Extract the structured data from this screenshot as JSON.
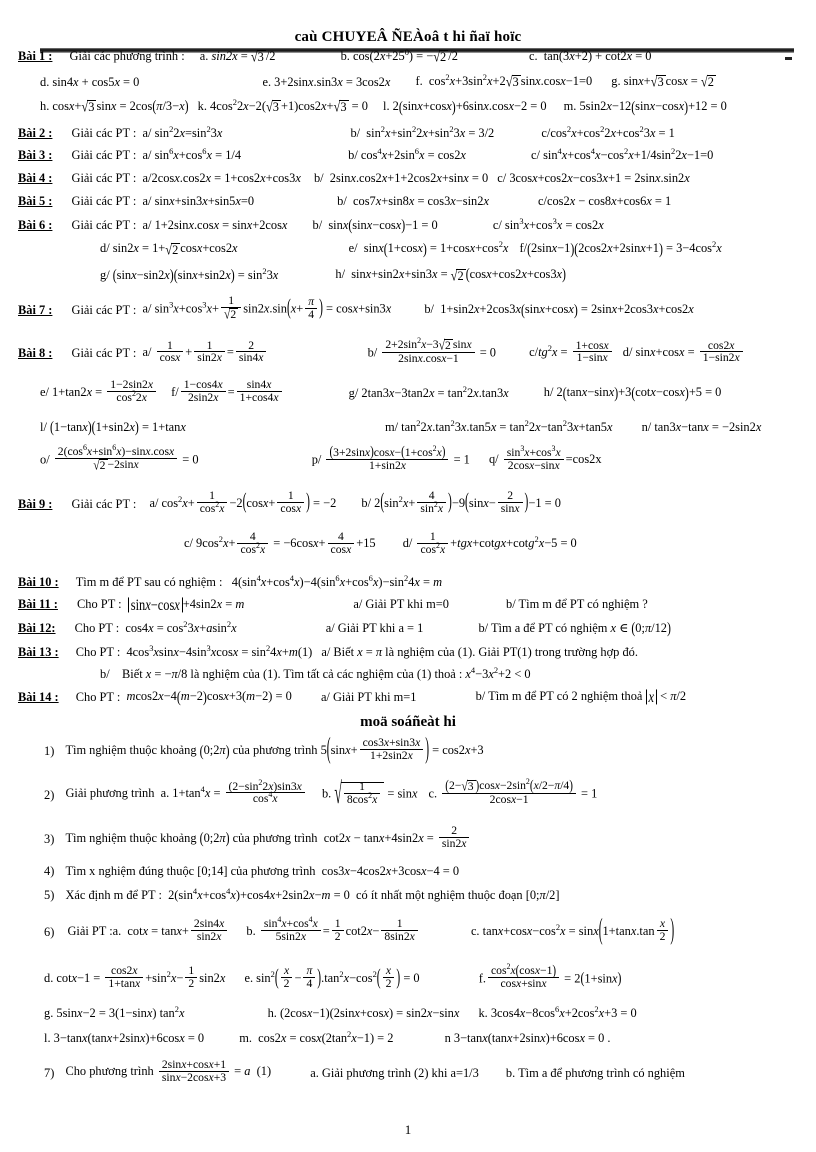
{
  "document": {
    "title": "caù CHUYEÂ ÑEÀoâ t hi ñaï hoïc",
    "section_title": "moä soáñeàt hi",
    "page_number": "1"
  },
  "part1": {
    "items": [
      {
        "label": "Bài 1 :",
        "stem": "Giải các phương trình :",
        "lines": [
          [
            {
              "key": "a.",
              "eq": "sin 2x = √3 / 2"
            },
            {
              "key": "b.",
              "eq": "cos(2x + 25⁰) = −√2 / 2"
            },
            {
              "key": "c.",
              "eq": "tan(3x + 2) + cot 2x = 0"
            }
          ],
          [
            {
              "key": "d.",
              "eq": "sin 4x + cos 5x = 0"
            },
            {
              "key": "e.",
              "eq": "3 + 2 sin x.sin 3x = 3cos 2x"
            },
            {
              "key": "f.",
              "eq": "cos² x + 3 sin² x + 2√3 sin x.cos x − 1 = 0"
            },
            {
              "key": "g.",
              "eq": "sin x + √3 cos x = √2"
            }
          ],
          [
            {
              "key": "h.",
              "eq": "cos x + √3 sin x = 2 cos(π/3 − x)"
            },
            {
              "key": "k.",
              "eq": "4cos² 2x − 2(√3 + 1) cos 2x + √3 = 0"
            },
            {
              "key": "l.",
              "eq": "2(sin x + cos x) + 6 sin x.cos x − 2 = 0"
            },
            {
              "key": "m.",
              "eq": "5 sin 2x − 12(sin x − cos x) + 12 = 0"
            }
          ]
        ]
      },
      {
        "label": "Bài 2 :",
        "stem": "Giải các PT :",
        "lines": [
          [
            {
              "key": "a/",
              "eq": "sin² 2x = sin² 3x"
            },
            {
              "key": "b/",
              "eq": "sin² x + sin² 2x + sin² 3x = 3/2"
            },
            {
              "key": "c/",
              "eq": "cos² x + cos² 2x + cos² 3x = 1"
            }
          ]
        ]
      },
      {
        "label": "Bài 3 :",
        "stem": "Giải các PT :",
        "lines": [
          [
            {
              "key": "a/",
              "eq": "sin⁶ x + cos⁶ x = 1/4"
            },
            {
              "key": "b/",
              "eq": "cos⁴ x + 2 sin⁶ x = cos 2x"
            },
            {
              "key": "c/",
              "eq": "sin⁴ x + cos⁴ x − cos² x + 1/4 sin² 2x − 1 = 0"
            }
          ]
        ]
      },
      {
        "label": "Bài 4 :",
        "stem": "Giải các PT :",
        "lines": [
          [
            {
              "key": "a/",
              "eq": "2 cos x.cos 2x = 1 + cos 2x + cos 3x"
            },
            {
              "key": "b/",
              "eq": "2 sin x.cos 2x + 1 + 2 cos 2x + sin x = 0"
            },
            {
              "key": "c/",
              "eq": "3 cos x + cos 2x − cos 3x + 1 = 2 sin x.sin 2x"
            }
          ]
        ]
      },
      {
        "label": "Bài 5 :",
        "stem": "Giải các PT :",
        "lines": [
          [
            {
              "key": "a/",
              "eq": "sin x + sin 3x + sin 5x = 0"
            },
            {
              "key": "b/",
              "eq": "cos 7x + sin 8x = cos 3x − sin 2x"
            },
            {
              "key": "c/",
              "eq": "cos 2x − cos 8x + cos 6x = 1"
            }
          ]
        ]
      },
      {
        "label": "Bài 6 :",
        "stem": "Giải các PT :",
        "lines": [
          [
            {
              "key": "a/",
              "eq": "1 + 2 sin x.cos x = sin x + 2 cos x"
            },
            {
              "key": "b/",
              "eq": "sin x(sin x − cos x) − 1 = 0"
            },
            {
              "key": "c/",
              "eq": "sin³ x + cos³ x = cos 2x"
            }
          ],
          [
            {
              "key": "d/",
              "eq": "sin 2x = 1 + √2 cos x + cos 2x"
            },
            {
              "key": "e/",
              "eq": "sin x(1 + cos x) = 1 + cos x + cos² x"
            },
            {
              "key": "f/",
              "eq": "(2 sin x − 1)(2 cos 2x + 2 sin x + 1) = 3 − 4cos² x"
            }
          ],
          [
            {
              "key": "g/",
              "eq": "(sin x − sin 2x)(sin x + sin 2x) = sin² 3x"
            },
            {
              "key": "h/",
              "eq": "sin x + sin 2x + sin 3x = √2 (cos x + cos 2x + cos 3x)"
            }
          ]
        ]
      },
      {
        "label": "Bài 7 :",
        "stem": "Giải các PT :",
        "lines": [
          [
            {
              "key": "a/",
              "eq": "sin³ x + cos³ x + (1/√2) sin 2x.sin(x + π/4) = cos x + sin 3x"
            },
            {
              "key": "b/",
              "eq": "1 + sin 2x + 2 cos 3x(sin x + cos x) = 2 sin x + 2 cos 3x + cos 2x"
            }
          ]
        ]
      },
      {
        "label": "Bài 8 :",
        "stem": "Giải các PT :",
        "lines": [
          [
            {
              "key": "a/",
              "eq": "1/cos x + 1/sin 2x = 2/sin 4x"
            },
            {
              "key": "b/",
              "eq": "(2 + 2 sin² x − 3√2 sin x)/(2 sin x.cos x − 1) = 0"
            },
            {
              "key": "c/",
              "eq": "tg² x = (1 + cos x)/(1 − sin x)"
            },
            {
              "key": "d/",
              "eq": "sin x + cos x = cos 2x/(1 − sin 2x)"
            }
          ],
          [
            {
              "key": "e/",
              "eq": "1 + tan 2x = (1 − 2 sin 2x)/cos² 2x"
            },
            {
              "key": "f/",
              "eq": "(1 − cos 4x)/(2 sin 2x) = sin 4x/(1 + cos 4x)"
            },
            {
              "key": "g/",
              "eq": "2 tan 3x − 3 tan 2x = tan² 2x.tan 3x"
            },
            {
              "key": "h/",
              "eq": "2(tan x − sin x) + 3(cot x − cos x) + 5 = 0"
            }
          ],
          [
            {
              "key": "l/",
              "eq": "(1 − tan x)(1 + sin 2x) = 1 + tan x"
            },
            {
              "key": "m/",
              "eq": "tan² 2x.tan² 3x.tan 5x = tan² 2x − tan² 3x + tan 5x"
            },
            {
              "key": "n/",
              "eq": "tan 3x − tan x = −2 sin 2x"
            }
          ],
          [
            {
              "key": "o/",
              "eq": "(2(cos⁶ x + sin⁶ x) − sin x.cos x)/(√2 − 2 sin x) = 0"
            },
            {
              "key": "p/",
              "eq": "((3 + 2 sin x)cos x − (1 + cos² x))/(1 + sin 2x) = 1"
            },
            {
              "key": "q/",
              "eq": "(sin³ x + cos³ x)/(2 cos x − sin x) = cos2x"
            }
          ]
        ]
      },
      {
        "label": "Bài 9 :",
        "stem": "Giải các PT :",
        "lines": [
          [
            {
              "key": "a/",
              "eq": "cos² x + 1/cos² x − 2(cos x + 1/cos x) = −2"
            },
            {
              "key": "b/",
              "eq": "2(sin² x + 4/sin² x) − 9(sin x − 2/sin x) − 1 = 0"
            }
          ],
          [
            {
              "key": "c/",
              "eq": "9cos² x + 4/cos² x = −6 cos x + 4/cos x + 15"
            },
            {
              "key": "d/",
              "eq": "1/cos² x + tgx + cot gx + cot g² x − 5 = 0"
            }
          ]
        ]
      },
      {
        "label": "Bài 10 :",
        "stem": "Tìm m để PT sau có nghiệm :",
        "lines": [
          [
            {
              "key": "",
              "eq": "4(sin⁴ x + cos⁴ x) − 4(sin⁶ x + cos⁶ x) − sin² 4x = m"
            }
          ]
        ]
      },
      {
        "label": "Bài 11 :",
        "stem": "Cho PT :",
        "lines": [
          [
            {
              "key": "",
              "eq": "|sin x − cos x| + 4 sin 2x = m"
            },
            {
              "key": "a/",
              "eq": "Giải PT khi m=0"
            },
            {
              "key": "b/",
              "eq": "Tìm m để PT có nghiệm ?"
            }
          ]
        ]
      },
      {
        "label": "Bài 12:",
        "stem": "Cho PT :",
        "lines": [
          [
            {
              "key": "",
              "eq": "cos 4x = cos² 3x + a sin² x"
            },
            {
              "key": "a/",
              "eq": "Giải PT khi a = 1"
            },
            {
              "key": "b/",
              "eq": "Tìm a để PT có nghiệm x ∈ (0; π/12)"
            }
          ]
        ]
      },
      {
        "label": "Bài 13 :",
        "stem": "Cho PT :",
        "lines": [
          [
            {
              "key": "",
              "eq": "4cos³ x sin x − 4sin³ x cos x = sin² 4x + m(1)"
            },
            {
              "key": "a/",
              "eq": "Biết x = π là nghiệm của (1). Giải PT(1) trong trường hợp đó."
            }
          ],
          [
            {
              "key": "b/",
              "eq": "Biết x = −π/8 là nghiệm của (1). Tìm tất cả các nghiệm của (1) thoả : x⁴ − 3x² + 2 < 0"
            }
          ]
        ]
      },
      {
        "label": "Bài 14 :",
        "stem": "Cho PT :",
        "lines": [
          [
            {
              "key": "",
              "eq": "m cos 2x − 4(m − 2)cos x + 3(m − 2) = 0"
            },
            {
              "key": "a/",
              "eq": "Giải PT khi m=1"
            },
            {
              "key": "b/",
              "eq": "Tìm m để PT có 2 nghiệm thoả |x| < π/2"
            }
          ]
        ]
      }
    ]
  },
  "part2": {
    "items": [
      {
        "num": "1)",
        "text": "Tìm nghiệm thuộc khoảng (0; 2π) của phương trình",
        "eq": "5(sin x + (cos 3x + sin 3x)/(1 + 2 sin 2x)) = cos 2x + 3"
      },
      {
        "num": "2)",
        "text": "Giải phương trình",
        "subs": [
          {
            "key": "a.",
            "eq": "1 + tan⁴ x = (2 − sin² 2x) sin 3x / cos⁴ x"
          },
          {
            "key": "b.",
            "eq": "√(1 / (8cos² x)) = sin x"
          },
          {
            "key": "c.",
            "eq": "((2 − √3) cos x − 2sin²(x/2 − π/4)) / (2 cos x − 1) = 1"
          }
        ]
      },
      {
        "num": "3)",
        "text": "Tìm nghiệm thuộc khoảng (0; 2π) của phương trình",
        "eq": "cot 2x − tan x + 4 sin 2x = 2 / sin 2x"
      },
      {
        "num": "4)",
        "text": "Tìm x nghiệm đúng thuộc [0;14] của phương trình",
        "eq": "cos 3x − 4 cos 2x + 3 cos x − 4 = 0"
      },
      {
        "num": "5)",
        "text": "Xác định m để PT :",
        "eq": "2(sin⁴ x + cos⁴ x) + cos 4x + 2 sin 2x − m = 0",
        "tail": "có ít nhất một nghiệm thuộc đoạn [0; π/2]"
      },
      {
        "num": "6)",
        "text": "Giải PT :",
        "subs": [
          {
            "key": "a.",
            "eq": "cot x = tan x + 2 sin 4x / sin 2x"
          },
          {
            "key": "b.",
            "eq": "(sin⁴ x + cos⁴ x)/(5 sin 2x) = (1/2) cot 2x − 1/(8 sin 2x)"
          },
          {
            "key": "c.",
            "eq": "tan x + cos x − cos² x = sin x(1 + tan x.tan(x/2))"
          },
          {
            "key": "d.",
            "eq": "cot x − 1 = cos 2x/(1 + tan x) + sin² x − (1/2) sin 2x"
          },
          {
            "key": "e.",
            "eq": "sin²(x/2 − π/4).tan² x − cos²(x/2) = 0"
          },
          {
            "key": "f.",
            "eq": "cos² x(cos x − 1)/(cos x + sin x) = 2(1 + sin x)"
          },
          {
            "key": "g.",
            "eq": "5 sin x − 2 = 3(1 − sin x) tan² x"
          },
          {
            "key": "h.",
            "eq": "(2 cos x − 1)(2 sin x + cos x) = sin 2x − sin x"
          },
          {
            "key": "k.",
            "eq": "3 cos 4x − 8cos⁶ x + 2cos² x + 3 = 0"
          },
          {
            "key": "l.",
            "eq": "3 − tan x(tan x + 2 sin x) + 6 cos x = 0"
          },
          {
            "key": "m.",
            "eq": "cos 2x = cos x(2 tan² x − 1) = 2"
          },
          {
            "key": "n",
            "eq": "3 − tan x(tan x + 2 sin x) + 6 cos x = 0 ."
          }
        ]
      },
      {
        "num": "7)",
        "text": "Cho phương trình",
        "eq": "(2 sin x + cos x + 1)/(sin x − 2 cos x + 3) = a",
        "tag": "(1)",
        "subs": [
          {
            "key": "a.",
            "eq": "Giải phương trình (2) khi a=1/3"
          },
          {
            "key": "b.",
            "eq": "Tìm a để phương trình có nghiệm"
          }
        ]
      }
    ]
  }
}
